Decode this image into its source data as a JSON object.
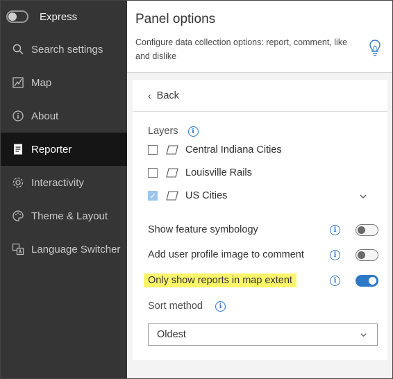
{
  "sidebar": {
    "title": "Express",
    "items": [
      {
        "label": "Search settings",
        "icon": "search-icon"
      },
      {
        "label": "Map",
        "icon": "map-icon"
      },
      {
        "label": "About",
        "icon": "info-icon"
      },
      {
        "label": "Reporter",
        "icon": "reporter-icon",
        "active": true
      },
      {
        "label": "Interactivity",
        "icon": "gear-icon"
      },
      {
        "label": "Theme & Layout",
        "icon": "palette-icon"
      },
      {
        "label": "Language Switcher",
        "icon": "language-icon"
      }
    ]
  },
  "header": {
    "title": "Panel options",
    "description": "Configure data collection options: report, comment, like and dislike"
  },
  "panel": {
    "back_label": "Back",
    "layers_label": "Layers",
    "layers": [
      {
        "name": "Central Indiana Cities",
        "checked": false
      },
      {
        "name": "Louisville Rails",
        "checked": false
      },
      {
        "name": "US Cities",
        "checked": true
      }
    ],
    "options": [
      {
        "label": "Show feature symbology",
        "enabled": false
      },
      {
        "label": "Add user profile image to comment",
        "enabled": false
      },
      {
        "label": "Only show reports in map extent",
        "enabled": true,
        "highlighted": true
      }
    ],
    "sort_label": "Sort method",
    "sort_value": "Oldest"
  },
  "colors": {
    "accent": "#2f79c7",
    "sidebar_bg": "#353535",
    "sidebar_active_bg": "#151515",
    "highlight": "#fbf56a"
  }
}
